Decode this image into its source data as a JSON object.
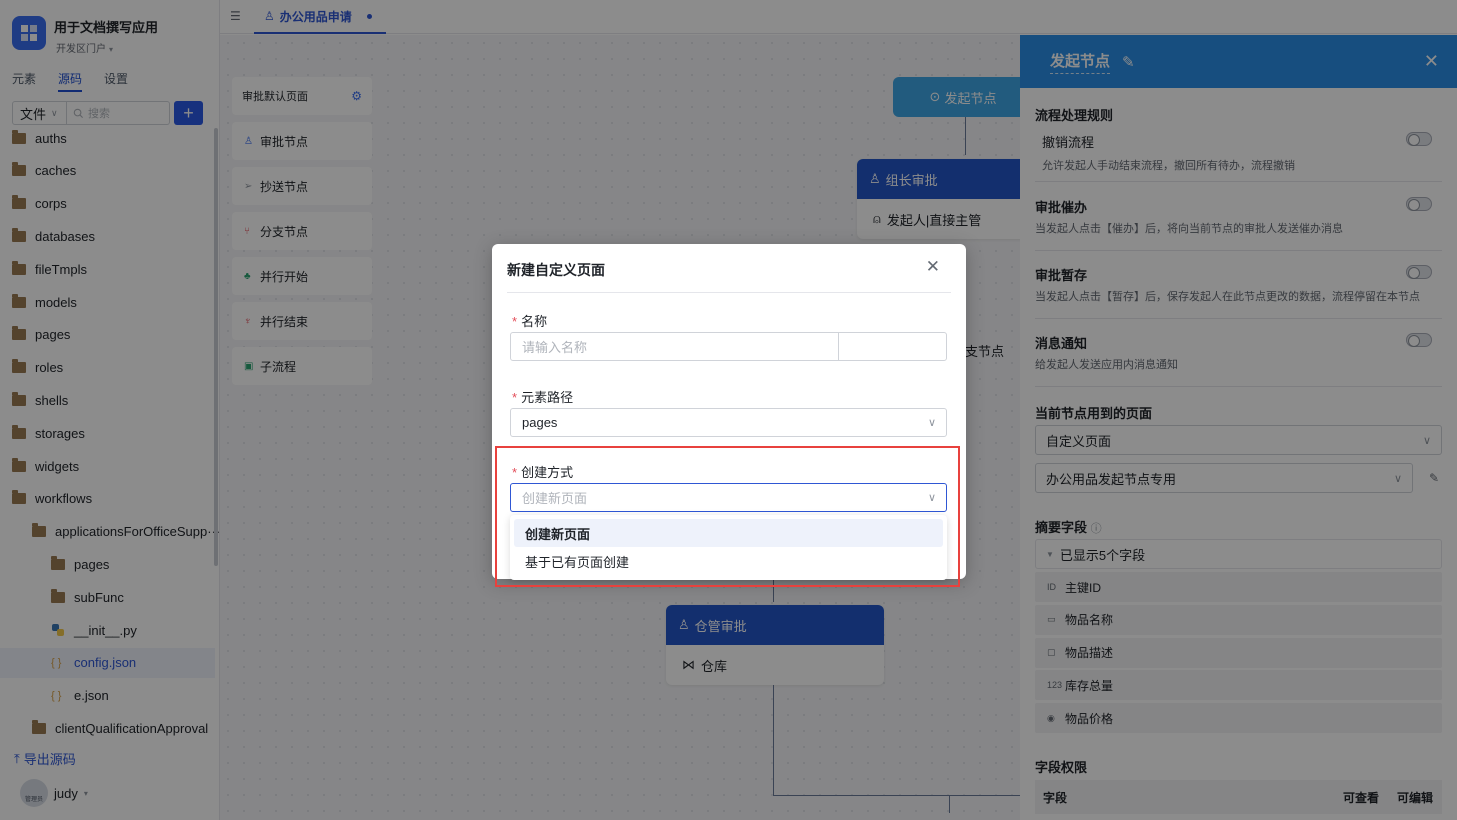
{
  "app": {
    "title": "用于文档撰写应用",
    "subtitle": "开发区门户",
    "brand_color": "#3a6df0"
  },
  "sidebar": {
    "tabs": [
      "元素",
      "源码",
      "设置"
    ],
    "active_tab": "源码",
    "file_select": "文件",
    "search_placeholder": "搜索",
    "add_label": "+",
    "tree": [
      {
        "label": "auths",
        "type": "folder",
        "level": 0
      },
      {
        "label": "caches",
        "type": "folder",
        "level": 0
      },
      {
        "label": "corps",
        "type": "folder",
        "level": 0
      },
      {
        "label": "databases",
        "type": "folder",
        "level": 0
      },
      {
        "label": "fileTmpls",
        "type": "folder",
        "level": 0
      },
      {
        "label": "models",
        "type": "folder",
        "level": 0
      },
      {
        "label": "pages",
        "type": "folder",
        "level": 0
      },
      {
        "label": "roles",
        "type": "folder",
        "level": 0
      },
      {
        "label": "shells",
        "type": "folder",
        "level": 0
      },
      {
        "label": "storages",
        "type": "folder",
        "level": 0
      },
      {
        "label": "widgets",
        "type": "folder",
        "level": 0
      },
      {
        "label": "workflows",
        "type": "folder-open",
        "level": 0
      },
      {
        "label": "applicationsForOfficeSupp···",
        "type": "folder-open",
        "level": 1
      },
      {
        "label": "pages",
        "type": "folder",
        "level": 2
      },
      {
        "label": "subFunc",
        "type": "folder",
        "level": 2
      },
      {
        "label": "__init__.py",
        "type": "python",
        "level": 2
      },
      {
        "label": "config.json",
        "type": "json",
        "level": 2,
        "selected": true
      },
      {
        "label": "e.json",
        "type": "json",
        "level": 2
      },
      {
        "label": "clientQualificationApproval",
        "type": "folder",
        "level": 1
      }
    ],
    "export_label": "导出源码",
    "user": {
      "name": "judy",
      "avatar_text": "管理员"
    }
  },
  "topbar": {
    "tab_label": "办公用品申请"
  },
  "canvas": {
    "palette_title": "审批默认页面",
    "palette_items": [
      {
        "label": "审批节点",
        "icon": "user-icon",
        "color": "#3a6df0"
      },
      {
        "label": "抄送节点",
        "icon": "send-icon",
        "color": "#8f959e"
      },
      {
        "label": "分支节点",
        "icon": "branch-icon",
        "color": "#e34d59"
      },
      {
        "label": "并行开始",
        "icon": "parallel-start-icon",
        "color": "#2ba471"
      },
      {
        "label": "并行结束",
        "icon": "parallel-end-icon",
        "color": "#e34d59"
      },
      {
        "label": "子流程",
        "icon": "subprocess-icon",
        "color": "#2ba471"
      }
    ],
    "start_node": "发起节点",
    "leader_node": {
      "title": "组长审批",
      "body": "发起人|直接主管"
    },
    "branch_label": "支节点",
    "warehouse_node": {
      "title": "仓管审批",
      "body": "仓库"
    }
  },
  "panel": {
    "title": "发起节点",
    "header_color": "#2b8fe8",
    "rules_title": "流程处理规则",
    "rules": [
      {
        "name": "撤销流程",
        "desc": "允许发起人手动结束流程，撤回所有待办，流程撤销",
        "enabled": false
      },
      {
        "name": "审批催办",
        "desc": "当发起人点击【催办】后，将向当前节点的审批人发送催办消息",
        "enabled": false
      },
      {
        "name": "审批暂存",
        "desc": "当发起人点击【暂存】后，保存发起人在此节点更改的数据，流程停留在本节点",
        "enabled": false
      },
      {
        "name": "消息通知",
        "desc": "给发起人发送应用内消息通知",
        "enabled": false
      }
    ],
    "pages_title": "当前节点用到的页面",
    "page_type": "自定义页面",
    "page_name": "办公用品发起节点专用",
    "summary_title": "摘要字段",
    "summary_head": "已显示5个字段",
    "summary_fields": [
      {
        "label": "主键ID",
        "icon": "id-icon"
      },
      {
        "label": "物品名称",
        "icon": "text-field-icon"
      },
      {
        "label": "物品描述",
        "icon": "textarea-icon"
      },
      {
        "label": "库存总量",
        "icon": "number-icon"
      },
      {
        "label": "物品价格",
        "icon": "currency-icon"
      }
    ],
    "perm_title": "字段权限",
    "perm_cols": [
      "字段",
      "可查看",
      "可编辑"
    ]
  },
  "modal": {
    "title": "新建自定义页面",
    "fields": {
      "name_label": "名称",
      "name_placeholder": "请输入名称",
      "path_label": "元素路径",
      "path_value": "pages",
      "mode_label": "创建方式",
      "mode_placeholder": "创建新页面"
    },
    "options": [
      "创建新页面",
      "基于已有页面创建"
    ],
    "active_option": "创建新页面",
    "highlight_color": "#e8413d"
  }
}
